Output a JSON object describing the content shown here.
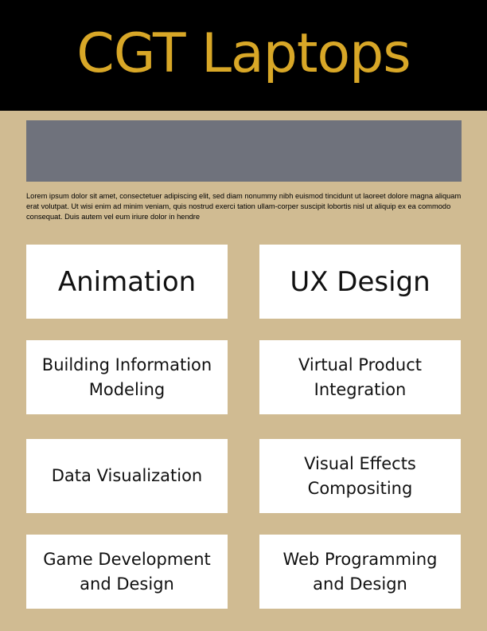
{
  "header": {
    "title": "CGT Laptops"
  },
  "intro": {
    "text": "Lorem ipsum dolor sit amet, consectetuer adipiscing elit, sed diam nonummy nibh euismod tincidunt ut laoreet dolore magna aliquam erat volutpat. Ut wisi enim ad minim veniam, quis nostrud exerci tation ullam-corper suscipit lobortis nisl ut aliquip ex ea commodo consequat. Duis autem vel eum iriure dolor in hendre"
  },
  "tiles": {
    "animation": "Animation",
    "ux_design": "UX Design",
    "bim": "Building Information Modeling",
    "virtual_product": "Virtual Product Integration",
    "data_viz": "Data Visualization",
    "vfx": "Visual Effects Compositing",
    "game_dev": "Game Development and Design",
    "web_prog": "Web Programming and Design"
  },
  "colors": {
    "background": "#d0bb92",
    "header_bg": "#000000",
    "title": "#d8a727",
    "banner": "#6f727c",
    "tile_bg": "#ffffff"
  }
}
